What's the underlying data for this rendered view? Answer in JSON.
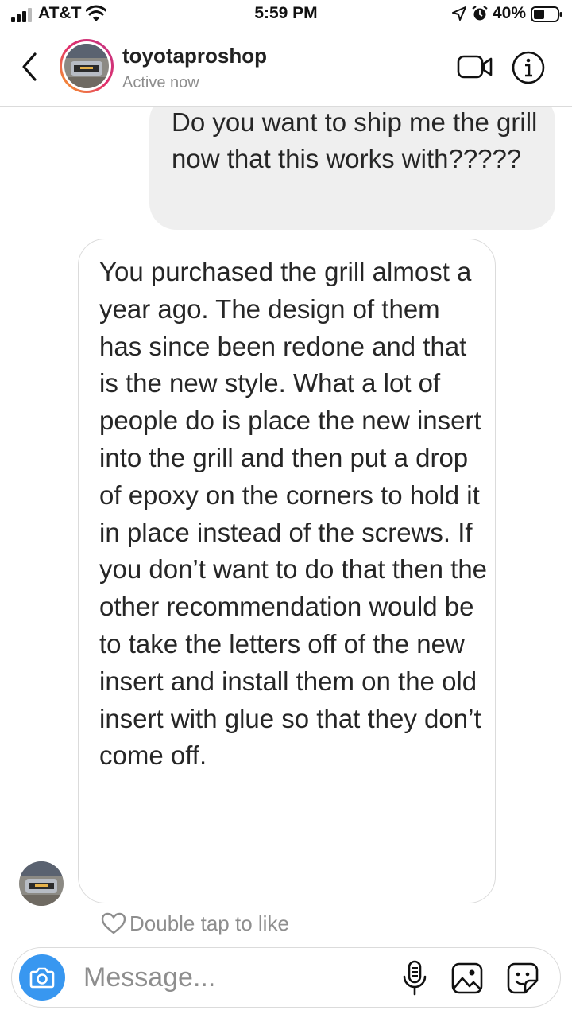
{
  "status_bar": {
    "carrier": "AT&T",
    "time": "5:59 PM",
    "battery": "40%"
  },
  "header": {
    "username": "toyotaproshop",
    "status": "Active now"
  },
  "messages": {
    "sent": "Do you want to ship me the grill now that this works with?????",
    "received": "You purchased the grill almost a year ago. The design of them has since been redone and that is the new style. What a lot of people do is place the new insert into the grill and then put a drop of epoxy on the corners to hold it in place instead of the screws. If you don’t want to do that then the other recommendation would be to take the letters off of the new insert and install them on the old insert with glue so that they don’t come off."
  },
  "like_hint": "Double tap to like",
  "composer": {
    "placeholder": "Message..."
  },
  "colors": {
    "accent_blue": "#3897f0",
    "sent_bubble": "#efefef",
    "secondary_text": "#8e8e8e",
    "border": "#dbdbdb"
  },
  "icons": [
    "signal-icon",
    "wifi-icon",
    "location-icon",
    "alarm-icon",
    "battery-icon",
    "back-chevron-icon",
    "video-call-icon",
    "info-icon",
    "heart-icon",
    "camera-icon",
    "microphone-icon",
    "gallery-icon",
    "sticker-icon"
  ]
}
